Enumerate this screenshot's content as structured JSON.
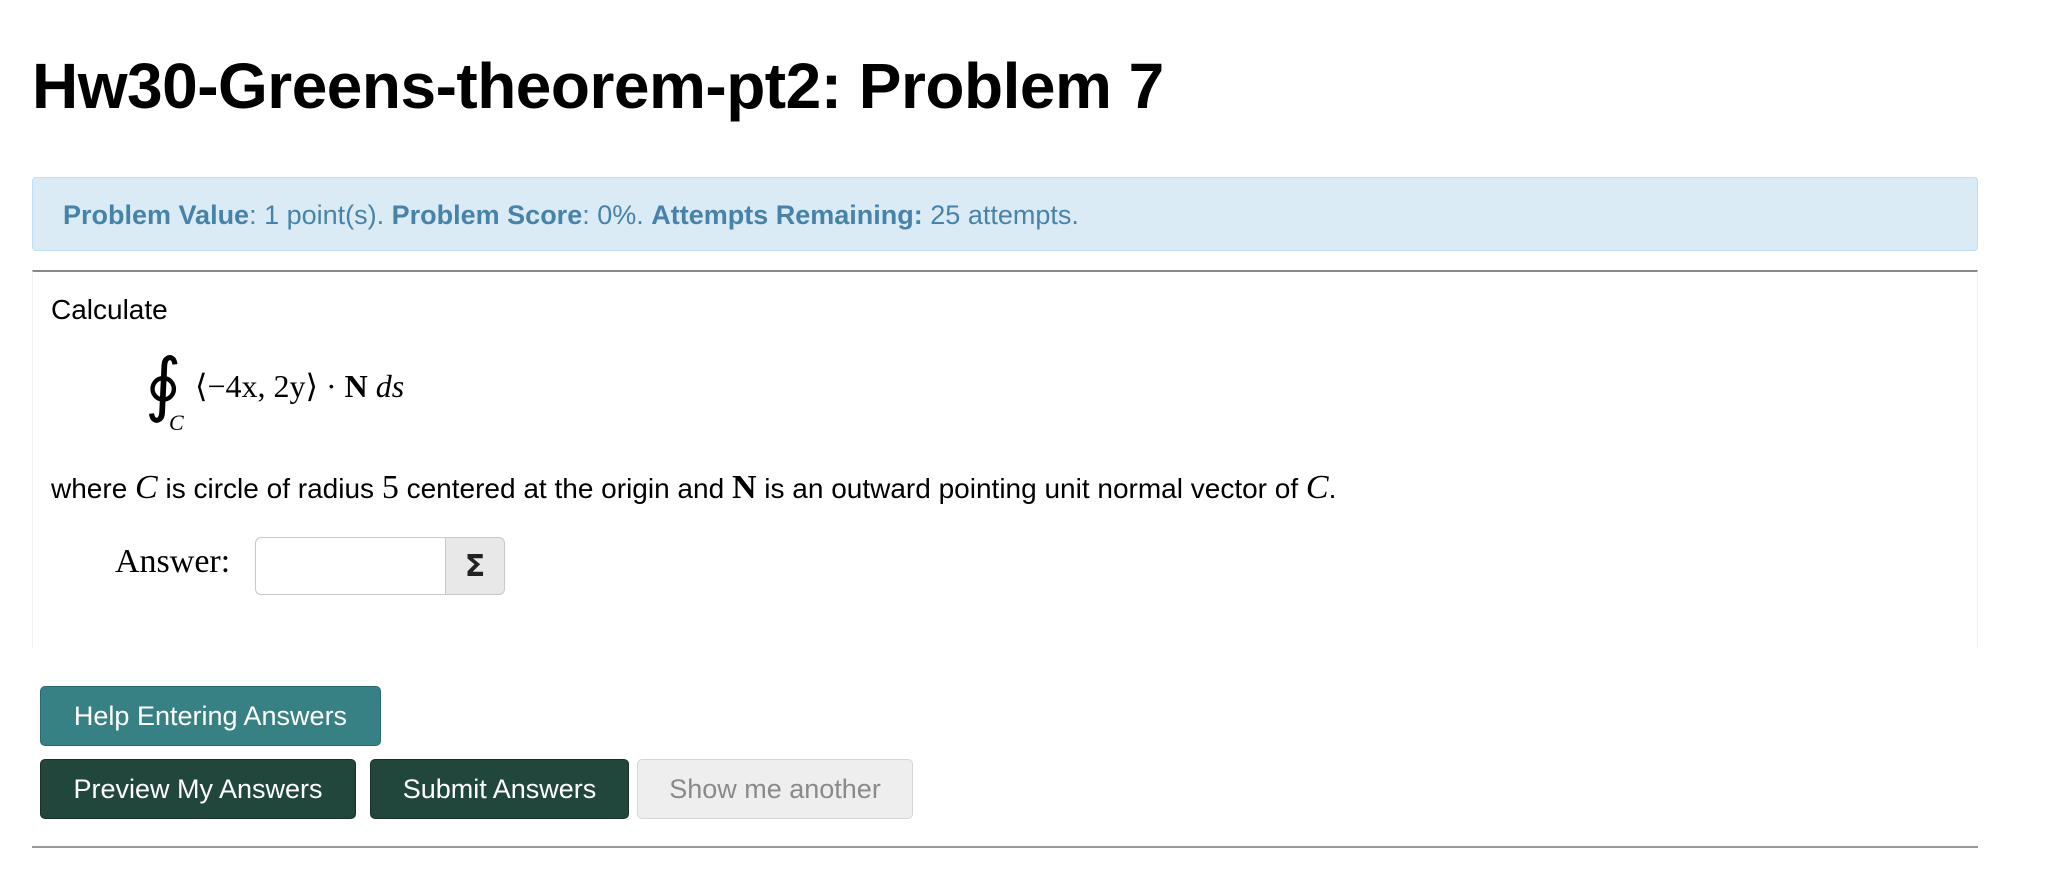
{
  "page": {
    "title": "Hw30-Greens-theorem-pt2: Problem 7"
  },
  "info": {
    "value_label": "Problem Value",
    "value_text": ": 1 point(s). ",
    "score_label": "Problem Score",
    "score_text": ": 0%. ",
    "attempts_label": "Attempts Remaining:",
    "attempts_text": " 25 attempts."
  },
  "problem": {
    "intro": "Calculate",
    "integral_sign": "∮",
    "integral_subscript": "C",
    "integrand_vector": "⟨−4x, 2y⟩",
    "dot": " · ",
    "normal_symbol": "N",
    "differential": " ds",
    "where_1": "where ",
    "curve_symbol": "C",
    "where_2": " is circle of radius ",
    "radius": "5",
    "where_3": " centered at the origin and ",
    "normal_symbol_2": "N",
    "where_4": " is an outward pointing unit normal vector of ",
    "curve_symbol_2": "C",
    "period": ".",
    "answer_label": "Answer:",
    "answer_value": "",
    "equation_editor_symbol": "Σ"
  },
  "buttons": {
    "help": "Help Entering Answers",
    "preview": "Preview My Answers",
    "submit": "Submit Answers",
    "another": "Show me another"
  }
}
